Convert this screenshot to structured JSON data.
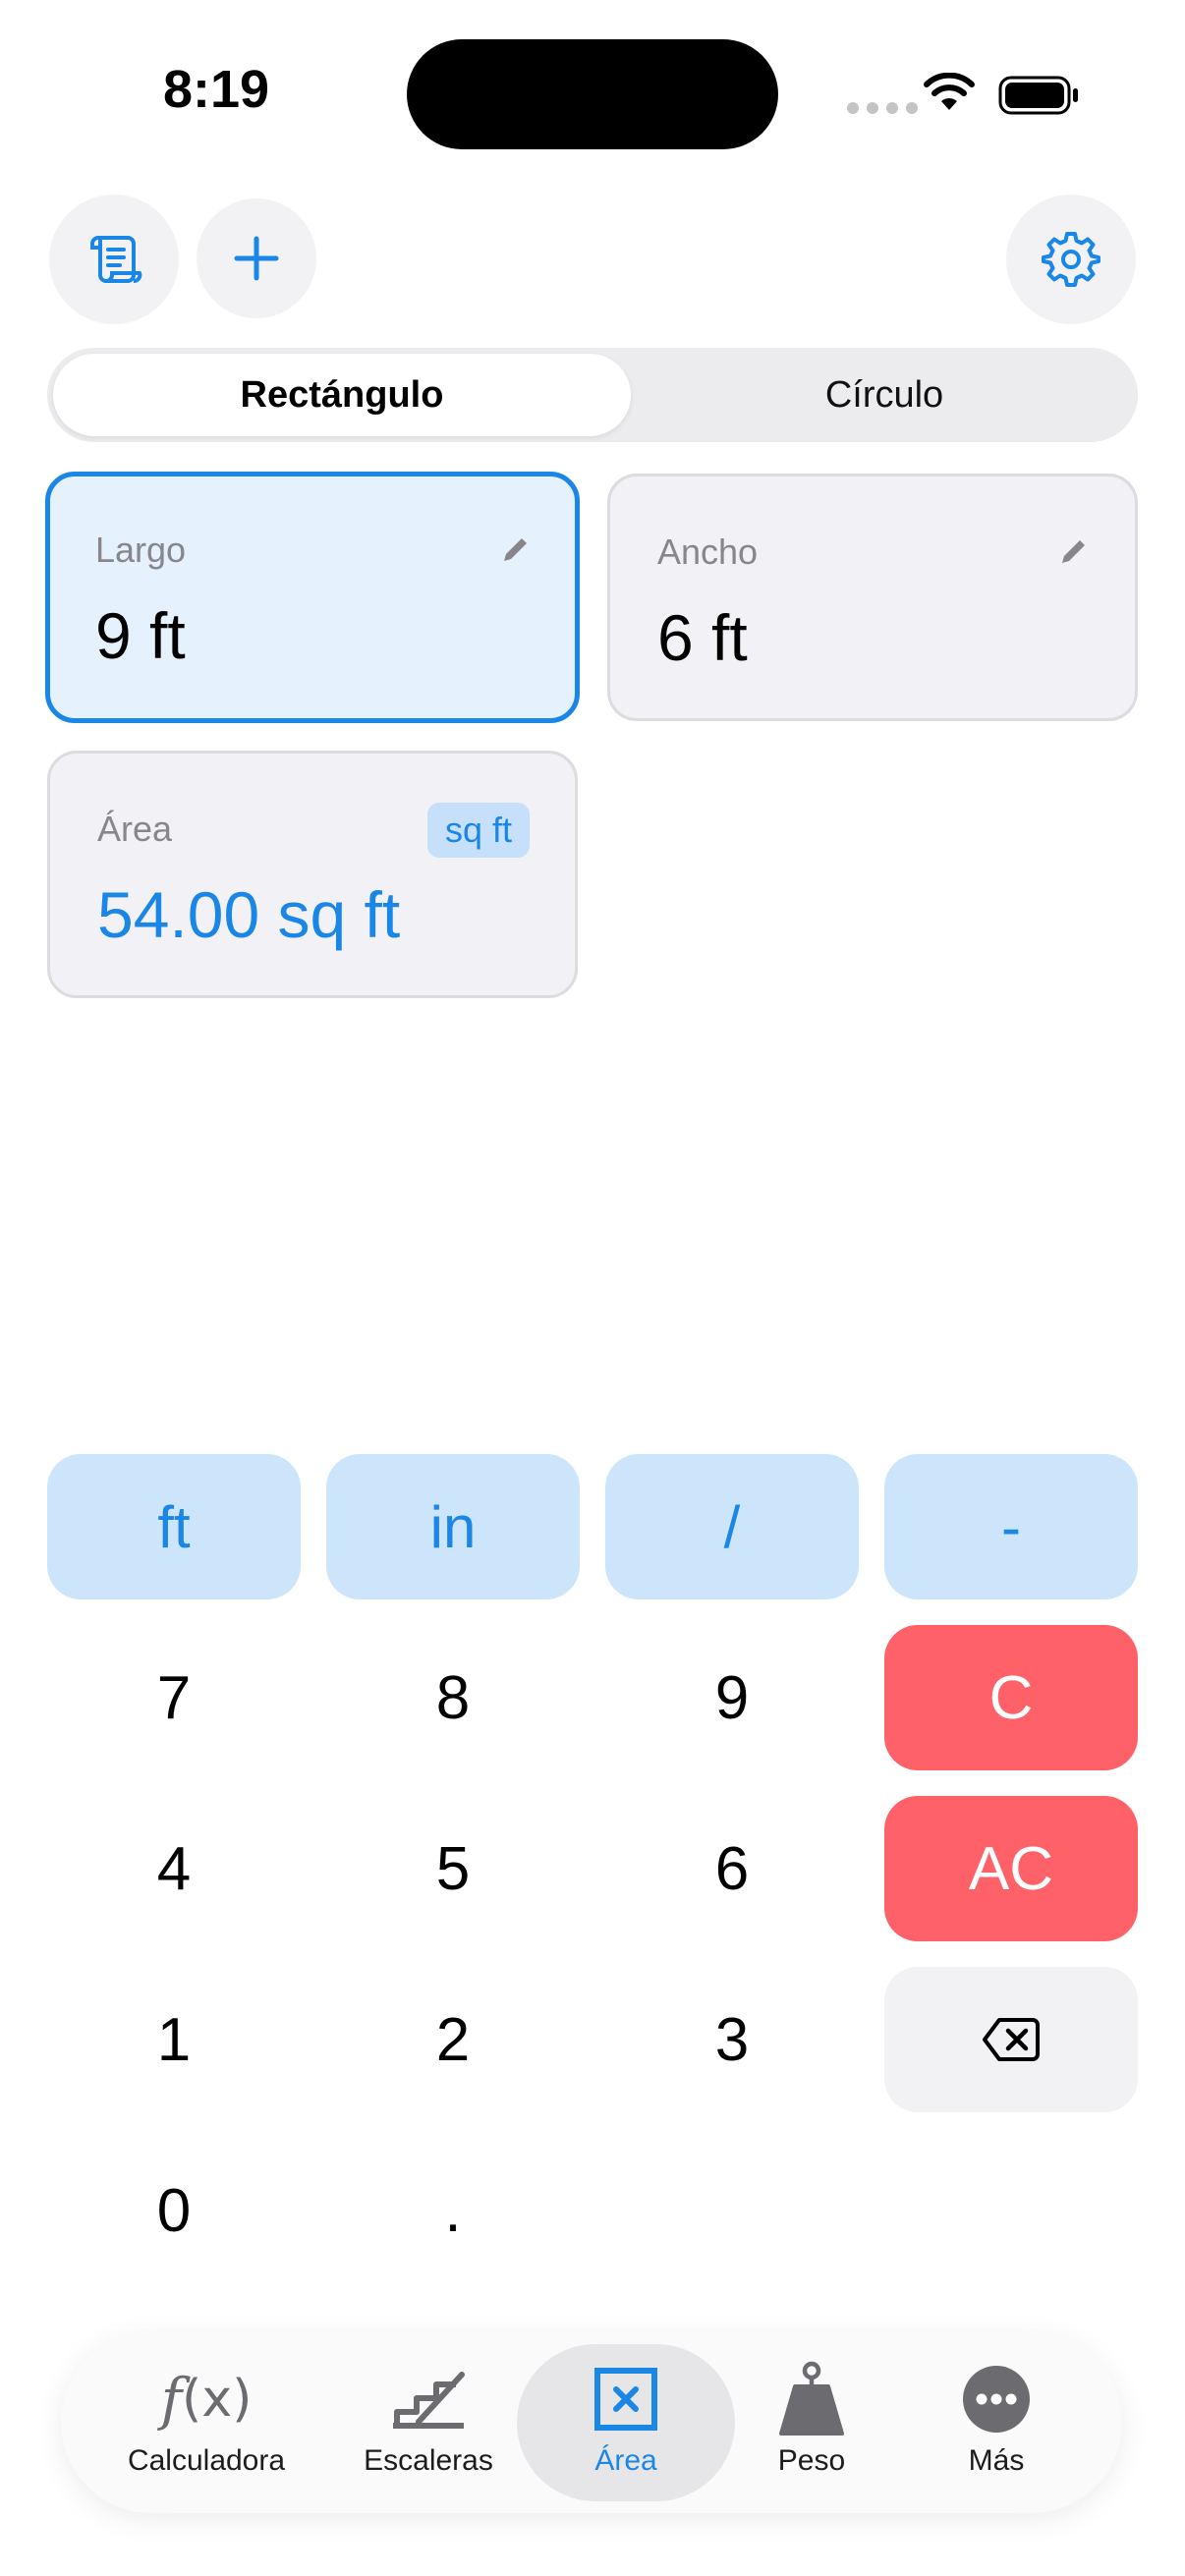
{
  "status": {
    "time": "8:19"
  },
  "segmented": {
    "options": [
      "Rectángulo",
      "Círculo"
    ],
    "selected": "Rectángulo"
  },
  "fields": {
    "largo": {
      "label": "Largo",
      "value": "9 ft"
    },
    "ancho": {
      "label": "Ancho",
      "value": "6 ft"
    },
    "area": {
      "label": "Área",
      "unit_badge": "sq ft",
      "value": "54.00 sq ft"
    }
  },
  "keypad": {
    "unit_row": [
      "ft",
      "in",
      "/",
      "-"
    ],
    "digits": [
      "7",
      "8",
      "9",
      "4",
      "5",
      "6",
      "1",
      "2",
      "3",
      "0",
      "."
    ],
    "clear": "C",
    "all_clear": "AC"
  },
  "tabs": [
    {
      "label": "Calculadora",
      "icon": "function-icon"
    },
    {
      "label": "Escaleras",
      "icon": "stairs-icon"
    },
    {
      "label": "Área",
      "icon": "area-icon"
    },
    {
      "label": "Peso",
      "icon": "weight-icon"
    },
    {
      "label": "Más",
      "icon": "more-icon"
    }
  ],
  "active_tab": "Área",
  "colors": {
    "accent": "#1a86e6",
    "danger": "#ff6168",
    "unit_key": "#cde5fb",
    "active_field": "#e5f1fd"
  }
}
